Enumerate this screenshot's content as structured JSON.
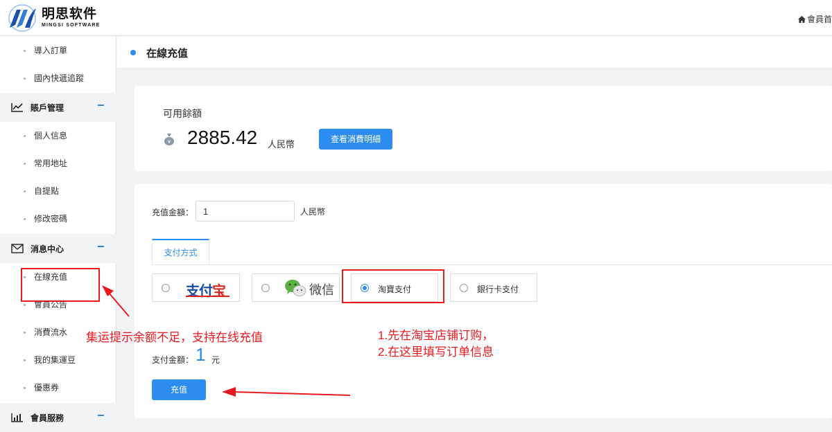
{
  "brand": {
    "name_cn": "明思软件",
    "name_en": "MINGSI SOFTWARE"
  },
  "topbar": {
    "member_home": "會員首"
  },
  "sidebar": {
    "items_top": [
      {
        "label": "導入訂單"
      },
      {
        "label": "國內快遞追蹤"
      }
    ],
    "group_account": {
      "label": "賬戶管理",
      "icon": "chart-line-icon"
    },
    "items_account": [
      {
        "label": "個人信息"
      },
      {
        "label": "常用地址"
      },
      {
        "label": "自提點"
      },
      {
        "label": "修改密碼"
      }
    ],
    "group_message": {
      "label": "消息中心",
      "icon": "mail-icon"
    },
    "items_message": [
      {
        "label": "在線充值"
      },
      {
        "label": "會員公告"
      },
      {
        "label": "消費流水"
      },
      {
        "label": "我的集運豆"
      },
      {
        "label": "優惠券"
      }
    ],
    "group_service": {
      "label": "會員服務",
      "icon": "bar-chart-icon"
    },
    "collapse_symbol": "−"
  },
  "page": {
    "title": "在線充值"
  },
  "balance": {
    "label": "可用餘額",
    "value": "2885.42",
    "unit": "人民幣",
    "detail_button": "查看消費明細"
  },
  "recharge": {
    "amount_label": "充值金額：",
    "amount_value": "1",
    "amount_unit": "人民幣",
    "tab_label": "支付方式",
    "options": [
      {
        "label": "支付宝",
        "icon": "alipay-logo",
        "selected": false
      },
      {
        "label": "微信",
        "icon": "wechat-logo",
        "selected": false
      },
      {
        "label": "淘寶支付",
        "selected": true
      },
      {
        "label": "銀行卡支付",
        "selected": false
      }
    ],
    "pay_total_label": "支付金額：",
    "pay_total_value": "1",
    "pay_total_unit": "元",
    "submit_button": "充值"
  },
  "annotations": {
    "note_left": "集运提示余额不足，支持在线充值",
    "note_right_1": "1.先在淘宝店铺订购，",
    "note_right_2": "2.在这里填写订单信息",
    "color": "#e8191f"
  },
  "colors": {
    "accent": "#2d8cf0",
    "annotation_red": "#e8191f"
  }
}
